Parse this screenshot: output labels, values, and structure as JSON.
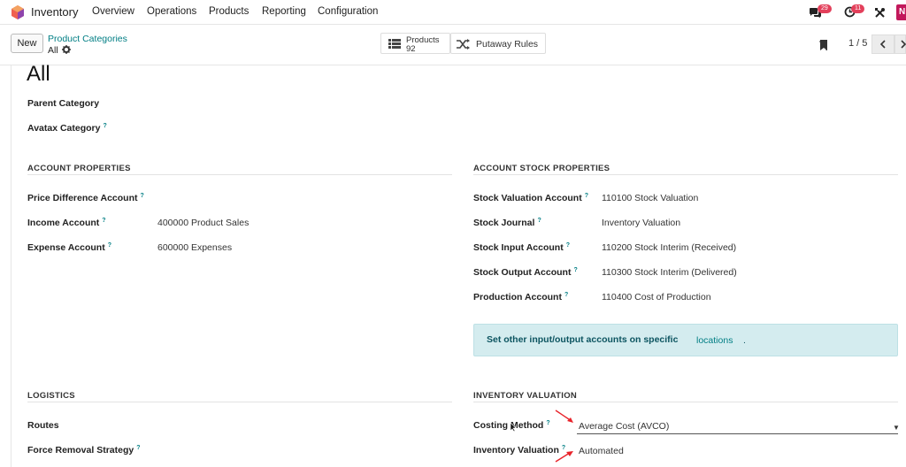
{
  "nav": {
    "app_name": "Inventory",
    "menu": [
      "Overview",
      "Operations",
      "Products",
      "Reporting",
      "Configuration"
    ],
    "messages_count": "29",
    "activities_count": "11",
    "avatar_initial": "N"
  },
  "control": {
    "new_label": "New",
    "breadcrumb_parent": "Product Categories",
    "breadcrumb_current": "All",
    "smart_products_label": "Products",
    "smart_products_count": "92",
    "smart_putaway_label": "Putaway Rules",
    "pager": "1 / 5"
  },
  "form": {
    "title": "All",
    "parent_category_label": "Parent Category",
    "avatax_category_label": "Avatax Category",
    "account_properties": {
      "heading": "ACCOUNT PROPERTIES",
      "fields": [
        {
          "label": "Price Difference Account",
          "value": ""
        },
        {
          "label": "Income Account",
          "value": "400000 Product Sales"
        },
        {
          "label": "Expense Account",
          "value": "600000 Expenses"
        }
      ]
    },
    "account_stock_properties": {
      "heading": "ACCOUNT STOCK PROPERTIES",
      "fields": [
        {
          "label": "Stock Valuation Account",
          "value": "110100 Stock Valuation"
        },
        {
          "label": "Stock Journal",
          "value": "Inventory Valuation"
        },
        {
          "label": "Stock Input Account",
          "value": "110200 Stock Interim (Received)"
        },
        {
          "label": "Stock Output Account",
          "value": "110300 Stock Interim (Delivered)"
        },
        {
          "label": "Production Account",
          "value": "110400 Cost of Production"
        }
      ]
    },
    "alert": {
      "text": "Set other input/output accounts on specific",
      "link": "locations",
      "suffix": "."
    },
    "logistics": {
      "heading": "LOGISTICS",
      "routes_label": "Routes",
      "force_removal_label": "Force Removal Strategy"
    },
    "inventory_valuation": {
      "heading": "INVENTORY VALUATION",
      "costing_method_label": "Costing Method",
      "costing_method_value": "Average Cost (AVCO)",
      "inventory_valuation_label": "Inventory Valuation",
      "inventory_valuation_value": "Automated"
    },
    "help_mark": "?"
  },
  "colors": {
    "accent": "#017e84",
    "badge": "#e3405b",
    "alert_bg": "#d4ecef",
    "annotation_arrow": "#e8232a"
  }
}
